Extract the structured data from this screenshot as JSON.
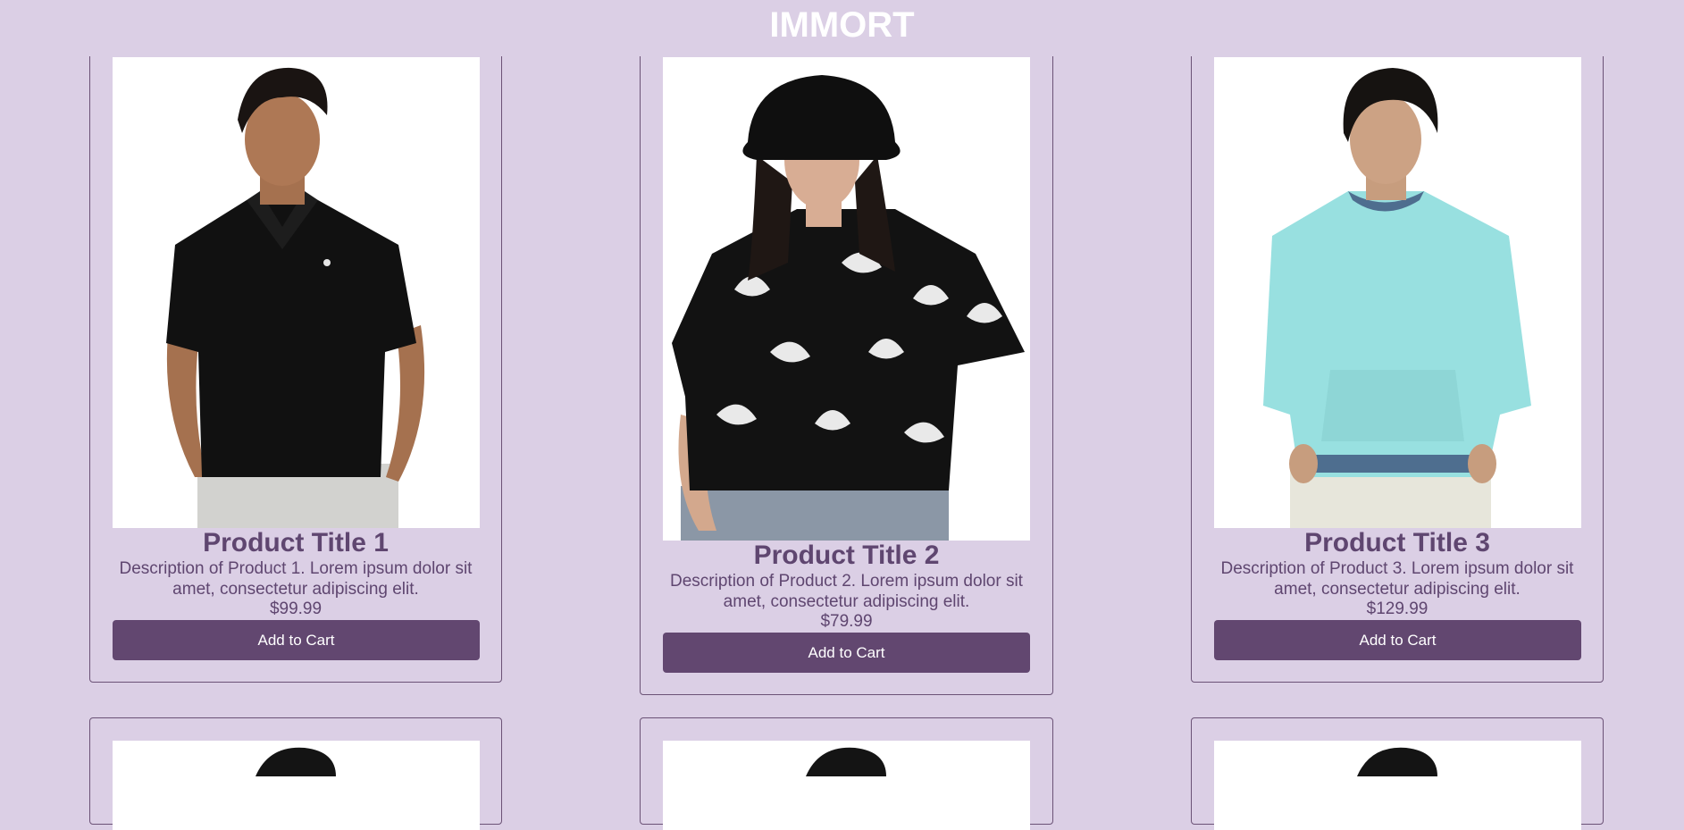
{
  "header": {
    "title": "IMMORT"
  },
  "products": [
    {
      "title": "Product Title 1",
      "description": "Description of Product 1. Lorem ipsum dolor sit amet, consectetur adipiscing elit.",
      "price": "$99.99",
      "button_label": "Add to Cart",
      "image_icon": "man-black-polo-photo"
    },
    {
      "title": "Product Title 2",
      "description": "Description of Product 2. Lorem ipsum dolor sit amet, consectetur adipiscing elit.",
      "price": "$79.99",
      "button_label": "Add to Cart",
      "image_icon": "woman-leaf-print-tshirt-photo"
    },
    {
      "title": "Product Title 3",
      "description": "Description of Product 3. Lorem ipsum dolor sit amet, consectetur adipiscing elit.",
      "price": "$129.99",
      "button_label": "Add to Cart",
      "image_icon": "man-aqua-sweatshirt-photo"
    }
  ],
  "colors": {
    "background": "#dbcfe5",
    "accent": "#624770",
    "text": "#5f4670"
  }
}
